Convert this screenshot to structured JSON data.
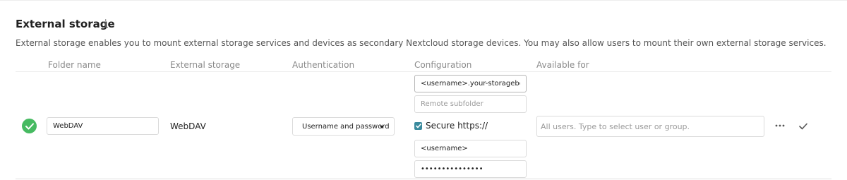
{
  "section": {
    "title": "External storage",
    "info_icon": "i",
    "description": "External storage enables you to mount external storage services and devices as secondary Nextcloud storage devices. You may also allow users to mount their own external storage services."
  },
  "columns": [
    "Folder name",
    "External storage",
    "Authentication",
    "Configuration",
    "Available for"
  ],
  "mount": {
    "status": "ok",
    "status_color": "#46ba61",
    "folder_name": "WebDAV",
    "external_storage": "WebDAV",
    "authentication": "Username and password",
    "configuration": {
      "host": "<username>.your-storagebox.de",
      "remote_subfolder_placeholder": "Remote subfolder",
      "secure_label": "Secure https://",
      "secure_checked": true,
      "username": "<username>",
      "password": "•••••••••••••••"
    },
    "available_for_placeholder": "All users. Type to select user or group."
  },
  "icons": {
    "status": "check-circle-icon",
    "more": "more-horizontal-icon",
    "save": "checkmark-icon",
    "caret": "caret-down-icon"
  },
  "colors": {
    "checkbox": "#3a8a9d",
    "status_ok": "#46ba61"
  }
}
